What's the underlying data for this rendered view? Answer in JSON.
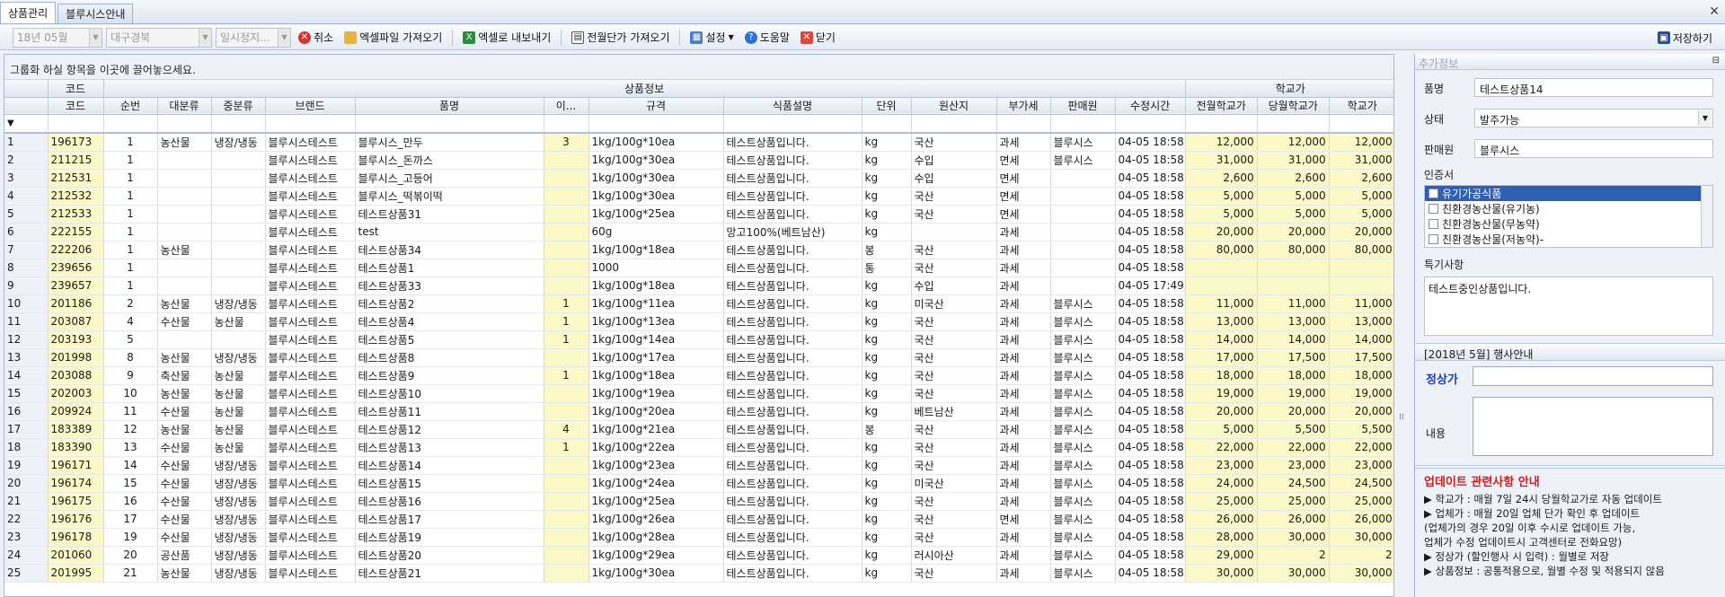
{
  "tabs": [
    {
      "label": "상품관리",
      "active": true
    },
    {
      "label": "블루시스안내",
      "active": false
    }
  ],
  "toolbar": {
    "combos": [
      {
        "value": "18년 05월",
        "width": 100
      },
      {
        "value": "대구경북",
        "width": 118
      },
      {
        "value": "일시정지...",
        "width": 84
      }
    ],
    "buttons": [
      {
        "icon": "cancel-icon",
        "label": "취소"
      },
      {
        "icon": "folder-open-icon",
        "label": "엑셀파일 가져오기"
      },
      {
        "icon": "excel-icon",
        "label": "엑셀로 내보내기"
      },
      {
        "icon": "table-icon",
        "label": "전월단가 가져오기"
      },
      {
        "icon": "calendar-icon",
        "label": "설정"
      },
      {
        "icon": "help-icon",
        "label": "도움말"
      },
      {
        "icon": "close-icon",
        "label": "닫기"
      }
    ],
    "save_label": "저장하기"
  },
  "grid": {
    "group_hint": "그룹화 하실 항목을 이곳에 끌어놓으세요.",
    "band_code": "코드",
    "band_product": "상품정보",
    "band_price": "학교가",
    "columns": [
      "코드",
      "순번",
      "대분류",
      "중분류",
      "브랜드",
      "품명",
      "이...",
      "규격",
      "식품설명",
      "단위",
      "원산지",
      "부가세",
      "판매원",
      "수정시간",
      "전월학교가",
      "당월학교가",
      "학교가"
    ],
    "rows": [
      [
        "1",
        "196173",
        "1",
        "농산물",
        "냉장/냉동",
        "블루시스테스트",
        "블루시스_만두",
        "3",
        "1kg/100g*10ea",
        "테스트상품입니다.",
        "kg",
        "국산",
        "과세",
        "블루시스",
        "04-05 18:58",
        "12,000",
        "12,000",
        "12,000"
      ],
      [
        "2",
        "211215",
        "1",
        "",
        "",
        "블루시스테스트",
        "블루시스_돈까스",
        "",
        "1kg/100g*30ea",
        "테스트상품입니다.",
        "kg",
        "수입",
        "면세",
        "블루시스",
        "04-05 18:58",
        "31,000",
        "31,000",
        "31,000"
      ],
      [
        "3",
        "212531",
        "1",
        "",
        "",
        "블루시스테스트",
        "블루시스_고등어",
        "",
        "1kg/100g*30ea",
        "테스트상품입니다.",
        "kg",
        "수입",
        "면세",
        "",
        "04-05 18:58",
        "2,600",
        "2,600",
        "2,600"
      ],
      [
        "4",
        "212532",
        "1",
        "",
        "",
        "블루시스테스트",
        "블루시스_떡볶이떡",
        "",
        "1kg/100g*30ea",
        "테스트상품입니다.",
        "kg",
        "국산",
        "면세",
        "",
        "04-05 18:58",
        "5,000",
        "5,000",
        "5,000"
      ],
      [
        "5",
        "212533",
        "1",
        "",
        "",
        "블루시스테스트",
        "테스트상품31",
        "",
        "1kg/100g*25ea",
        "테스트상품입니다.",
        "kg",
        "국산",
        "면세",
        "",
        "04-05 18:58",
        "5,000",
        "5,000",
        "5,000"
      ],
      [
        "6",
        "222155",
        "1",
        "",
        "",
        "블루시스테스트",
        "test",
        "",
        "60g",
        "망고100%(베트남산)",
        "kg",
        "",
        "과세",
        "",
        "04-05 18:58",
        "20,000",
        "20,000",
        "20,000"
      ],
      [
        "7",
        "222206",
        "1",
        "농산물",
        "",
        "블루시스테스트",
        "테스트상품34",
        "",
        "1kg/100g*18ea",
        "테스트상품입니다.",
        "봉",
        "국산",
        "과세",
        "",
        "04-05 18:58",
        "80,000",
        "80,000",
        "80,000"
      ],
      [
        "8",
        "239656",
        "1",
        "",
        "",
        "블루시스테스트",
        "테스트상품1",
        "",
        "1000",
        "테스트상품입니다.",
        "통",
        "국산",
        "과세",
        "",
        "04-05 18:58",
        "",
        "",
        ""
      ],
      [
        "9",
        "239657",
        "1",
        "",
        "",
        "블루시스테스트",
        "테스트상품33",
        "",
        "1kg/100g*18ea",
        "테스트상품입니다.",
        "kg",
        "수입",
        "과세",
        "",
        "04-05 17:49",
        "",
        "",
        ""
      ],
      [
        "10",
        "201186",
        "2",
        "농산물",
        "냉장/냉동",
        "블루시스테스트",
        "테스트상품2",
        "1",
        "1kg/100g*11ea",
        "테스트상품입니다.",
        "kg",
        "미국산",
        "과세",
        "블루시스",
        "04-05 18:58",
        "11,000",
        "11,000",
        "11,000"
      ],
      [
        "11",
        "203087",
        "4",
        "수산물",
        "농산물",
        "블루시스테스트",
        "테스트상품4",
        "1",
        "1kg/100g*13ea",
        "테스트상품입니다.",
        "kg",
        "국산",
        "과세",
        "블루시스",
        "04-05 18:58",
        "13,000",
        "13,000",
        "13,000"
      ],
      [
        "12",
        "203193",
        "5",
        "",
        "",
        "블루시스테스트",
        "테스트상품5",
        "1",
        "1kg/100g*14ea",
        "테스트상품입니다.",
        "kg",
        "국산",
        "과세",
        "블루시스",
        "04-05 18:58",
        "14,000",
        "14,000",
        "14,000"
      ],
      [
        "13",
        "201998",
        "8",
        "농산물",
        "냉장/냉동",
        "블루시스테스트",
        "테스트상품8",
        "",
        "1kg/100g*17ea",
        "테스트상품입니다.",
        "kg",
        "국산",
        "과세",
        "블루시스",
        "04-05 18:58",
        "17,000",
        "17,500",
        "17,500"
      ],
      [
        "14",
        "203088",
        "9",
        "축산물",
        "농산물",
        "블루시스테스트",
        "테스트상품9",
        "1",
        "1kg/100g*18ea",
        "테스트상품입니다.",
        "kg",
        "국산",
        "과세",
        "블루시스",
        "04-05 18:58",
        "18,000",
        "18,000",
        "18,000"
      ],
      [
        "15",
        "202003",
        "10",
        "농산물",
        "농산물",
        "블루시스테스트",
        "테스트상품10",
        "",
        "1kg/100g*19ea",
        "테스트상품입니다.",
        "kg",
        "국산",
        "과세",
        "블루시스",
        "04-05 18:58",
        "19,000",
        "19,000",
        "19,000"
      ],
      [
        "16",
        "209924",
        "11",
        "수산물",
        "농산물",
        "블루시스테스트",
        "테스트상품11",
        "",
        "1kg/100g*20ea",
        "테스트상품입니다.",
        "kg",
        "베트남산",
        "과세",
        "블루시스",
        "04-05 18:58",
        "20,000",
        "20,000",
        "20,000"
      ],
      [
        "17",
        "183389",
        "12",
        "농산물",
        "농산물",
        "블루시스테스트",
        "테스트상품12",
        "4",
        "1kg/100g*21ea",
        "테스트상품입니다.",
        "봉",
        "국산",
        "과세",
        "블루시스",
        "04-05 18:58",
        "5,000",
        "5,500",
        "5,500"
      ],
      [
        "18",
        "183390",
        "13",
        "수산물",
        "농산물",
        "블루시스테스트",
        "테스트상품13",
        "1",
        "1kg/100g*22ea",
        "테스트상품입니다.",
        "kg",
        "국산",
        "과세",
        "블루시스",
        "04-05 18:58",
        "22,000",
        "22,000",
        "22,000"
      ],
      [
        "19",
        "196171",
        "14",
        "수산물",
        "냉장/냉동",
        "블루시스테스트",
        "테스트상품14",
        "",
        "1kg/100g*23ea",
        "테스트상품입니다.",
        "kg",
        "국산",
        "과세",
        "블루시스",
        "04-05 18:58",
        "23,000",
        "23,000",
        "23,000"
      ],
      [
        "20",
        "196174",
        "15",
        "수산물",
        "냉장/냉동",
        "블루시스테스트",
        "테스트상품15",
        "",
        "1kg/100g*24ea",
        "테스트상품입니다.",
        "kg",
        "미국산",
        "과세",
        "블루시스",
        "04-05 18:58",
        "24,000",
        "24,500",
        "24,500"
      ],
      [
        "21",
        "196175",
        "16",
        "수산물",
        "냉장/냉동",
        "블루시스테스트",
        "테스트상품16",
        "",
        "1kg/100g*25ea",
        "테스트상품입니다.",
        "kg",
        "국산",
        "과세",
        "블루시스",
        "04-05 18:58",
        "25,000",
        "25,000",
        "25,000"
      ],
      [
        "22",
        "196176",
        "17",
        "수산물",
        "냉장/냉동",
        "블루시스테스트",
        "테스트상품17",
        "",
        "1kg/100g*26ea",
        "테스트상품입니다.",
        "kg",
        "국산",
        "면세",
        "블루시스",
        "04-05 18:58",
        "26,000",
        "26,000",
        "26,000"
      ],
      [
        "23",
        "196178",
        "19",
        "수산물",
        "냉장/냉동",
        "블루시스테스트",
        "테스트상품19",
        "",
        "1kg/100g*28ea",
        "테스트상품입니다.",
        "kg",
        "국산",
        "과세",
        "블루시스",
        "04-05 18:58",
        "28,000",
        "30,000",
        "30,000"
      ],
      [
        "24",
        "201060",
        "20",
        "공산품",
        "냉장/냉동",
        "블루시스테스트",
        "테스트상품20",
        "",
        "1kg/100g*29ea",
        "테스트상품입니다.",
        "kg",
        "러시아산",
        "과세",
        "블루시스",
        "04-05 18:58",
        "29,000",
        "2",
        "2"
      ],
      [
        "25",
        "201995",
        "21",
        "농산물",
        "냉장/냉동",
        "블루시스테스트",
        "테스트상품21",
        "",
        "1kg/100g*30ea",
        "테스트상품입니다.",
        "kg",
        "국산",
        "과세",
        "블루시스",
        "04-05 18:58",
        "30,000",
        "30,000",
        "30,000"
      ]
    ]
  },
  "side": {
    "header": "추가정보",
    "product_label": "품명",
    "product_value": "테스트상품14",
    "status_label": "상태",
    "status_value": "발주가능",
    "seller_label": "판매원",
    "seller_value": "블루시스",
    "cert_label": "인증서",
    "certs": [
      {
        "label": "유기가공식품",
        "selected": true
      },
      {
        "label": "친환경농산물(유기농)",
        "selected": false
      },
      {
        "label": "친환경농산물(무농약)",
        "selected": false
      },
      {
        "label": "친환경농산물(저농약)-",
        "selected": false
      }
    ],
    "memo_label": "특기사항",
    "memo_value": "테스트중인상품입니다.",
    "promo_band": "[2018년 5월] 행사안내",
    "promo_price_label": "정상가",
    "promo_content_label": "내용",
    "update_title": "업데이트 관련사항 안내",
    "updates": [
      "▶ 학교가 : 매월 7일 24시 당월학교가로 자동 업데이트",
      "▶ 업체가 : 매월 20일 업체 단가 확인 후 업데이트",
      "    (업체가의 경우 20일 이후 수시로 업데이트 가능,",
      "     업체가 수정 업데이트시 고객센터로 전화요망)",
      "▶ 정상가 (할인행사 시 입력) : 월별로 저장",
      "▶ 상품정보 : 공통적용으로, 월별 수정 및 적용되지 않음"
    ]
  },
  "colors": {
    "accent": "#2f5fb3",
    "highlight": "#fdf8c8",
    "notice": "#d11a1a",
    "promo": "#1a3fb8"
  }
}
